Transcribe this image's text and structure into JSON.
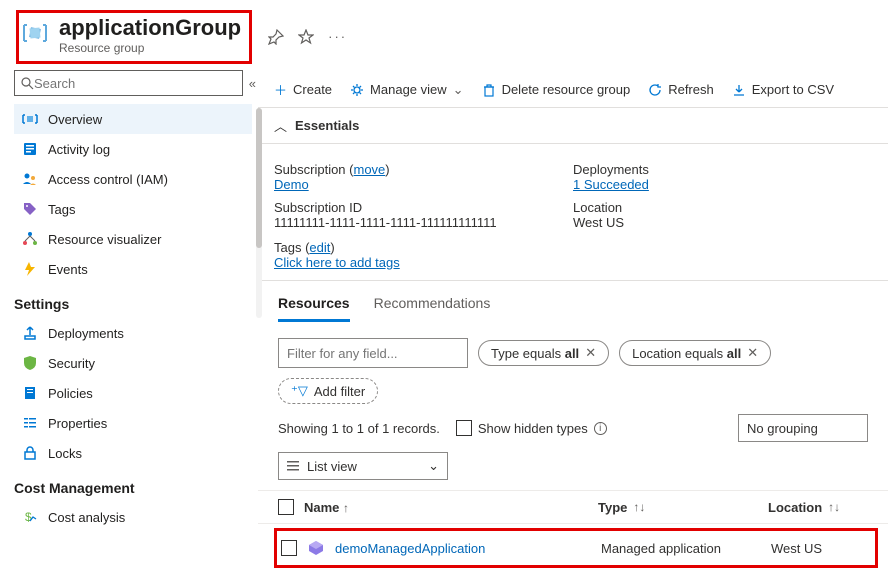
{
  "header": {
    "title": "applicationGroup",
    "subtitle": "Resource group"
  },
  "sidebar": {
    "search_placeholder": "Search",
    "items": [
      {
        "label": "Overview"
      },
      {
        "label": "Activity log"
      },
      {
        "label": "Access control (IAM)"
      },
      {
        "label": "Tags"
      },
      {
        "label": "Resource visualizer"
      },
      {
        "label": "Events"
      }
    ],
    "settings_header": "Settings",
    "settings": [
      {
        "label": "Deployments"
      },
      {
        "label": "Security"
      },
      {
        "label": "Policies"
      },
      {
        "label": "Properties"
      },
      {
        "label": "Locks"
      }
    ],
    "cost_header": "Cost Management",
    "cost": [
      {
        "label": "Cost analysis"
      }
    ]
  },
  "toolbar": {
    "create": "Create",
    "manage_view": "Manage view",
    "delete": "Delete resource group",
    "refresh": "Refresh",
    "export": "Export to CSV"
  },
  "essentials": {
    "header": "Essentials",
    "subscription_label": "Subscription",
    "move": "move",
    "subscription_link": "Demo",
    "subscription_id_label": "Subscription ID",
    "subscription_id": "11111111-1111-1111-1111-111111111111",
    "deployments_label": "Deployments",
    "deployments_link": "1 Succeeded",
    "location_label": "Location",
    "location": "West US",
    "tags_label": "Tags",
    "edit": "edit",
    "tags_link": "Click here to add tags"
  },
  "tabs": {
    "resources": "Resources",
    "recommendations": "Recommendations"
  },
  "filters": {
    "placeholder": "Filter for any field...",
    "type_pill_prefix": "Type equals ",
    "type_pill_value": "all",
    "location_pill_prefix": "Location equals ",
    "location_pill_value": "all",
    "add_filter": "Add filter"
  },
  "records": {
    "showing": "Showing 1 to 1 of 1 records.",
    "show_hidden": "Show hidden types",
    "list_view": "List view",
    "no_grouping": "No grouping"
  },
  "table": {
    "name_hdr": "Name",
    "type_hdr": "Type",
    "location_hdr": "Location",
    "rows": [
      {
        "name": "demoManagedApplication",
        "type": "Managed application",
        "location": "West US"
      }
    ]
  }
}
